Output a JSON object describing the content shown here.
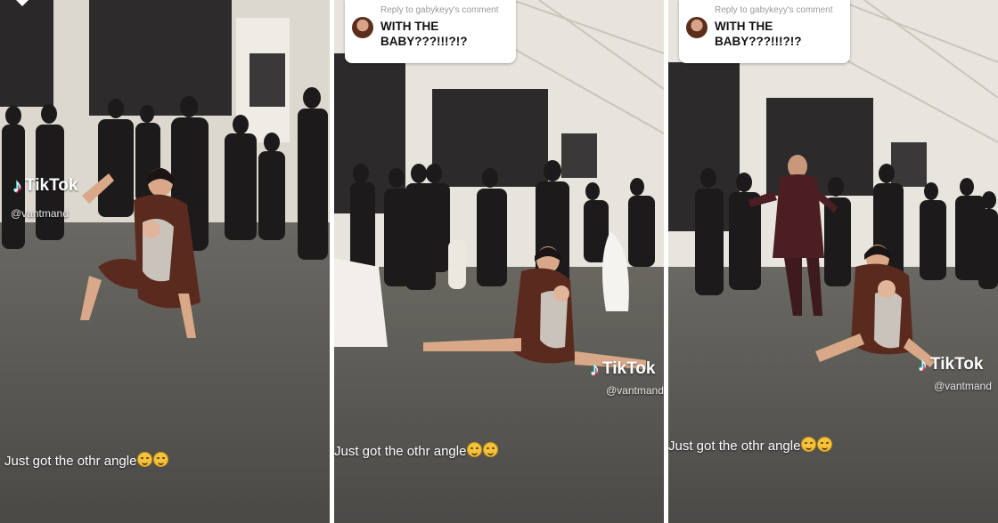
{
  "panels": [
    {
      "tiktok_label": "TikTok",
      "handle": "@vantmand",
      "caption": "Just got the othr angle",
      "caption_emoji": [
        "grimace-face-emoji",
        "grimace-face-emoji"
      ]
    },
    {
      "reply_bubble": {
        "reply_to": "Reply to gabykeyy's comment",
        "comment": "WITH THE BABY???!!!?!?"
      },
      "tiktok_label": "TikTok",
      "handle": "@vantmand",
      "caption": "Just got the othr angle",
      "caption_emoji": [
        "grimace-face-emoji",
        "grimace-face-emoji"
      ]
    },
    {
      "reply_bubble": {
        "reply_to": "Reply to gabykeyy's comment",
        "comment": "WITH THE BABY???!!!?!?"
      },
      "tiktok_label": "TikTok",
      "handle": "@vantmand",
      "caption": "Just got the othr angle",
      "caption_emoji": [
        "grimace-face-emoji",
        "grimace-face-emoji"
      ]
    }
  ],
  "colors": {
    "floor": "#5b5a56",
    "wall": "#e9e6df",
    "dark_panel": "#2c2a2a",
    "tiktok_cyan": "#25f4ee",
    "tiktok_red": "#fe2c55"
  }
}
